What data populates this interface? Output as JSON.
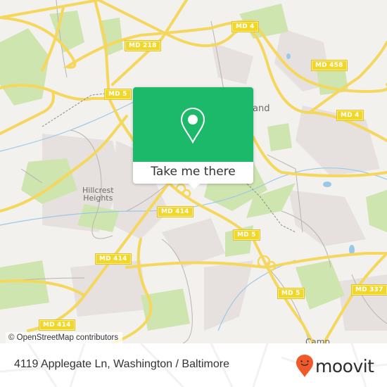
{
  "map": {
    "colors": {
      "land": "#f2f1ee",
      "park": "#cfe5b0",
      "urban": "#e6e1de",
      "road_major": "#f4d75c",
      "road_minor": "#b8b4b0",
      "water": "#9cc8e8",
      "shield": "#f1d72a"
    },
    "shields": [
      {
        "label": "MD 4"
      },
      {
        "label": "MD 218"
      },
      {
        "label": "MD 458"
      },
      {
        "label": "MD 5"
      },
      {
        "label": "MD 4"
      },
      {
        "label": "MD 414"
      },
      {
        "label": "MD 5"
      },
      {
        "label": "MD 414"
      },
      {
        "label": "MD 5"
      },
      {
        "label": "MD 337"
      },
      {
        "label": "MD 414"
      }
    ],
    "places": [
      {
        "line1": "Hillcrest",
        "line2": "Heights"
      },
      {
        "label": "and"
      },
      {
        "label": "Camp"
      }
    ],
    "attribution": "© OpenStreetMap contributors"
  },
  "popup": {
    "icon": "location-pin-icon",
    "button_label": "Take me there",
    "color": "#1db96a"
  },
  "footer": {
    "address": "4119 Applegate Ln, Washington / Baltimore",
    "brand": "moovit",
    "brand_icon": "moovit-pin-logo-icon",
    "brand_color": "#f1592a"
  }
}
